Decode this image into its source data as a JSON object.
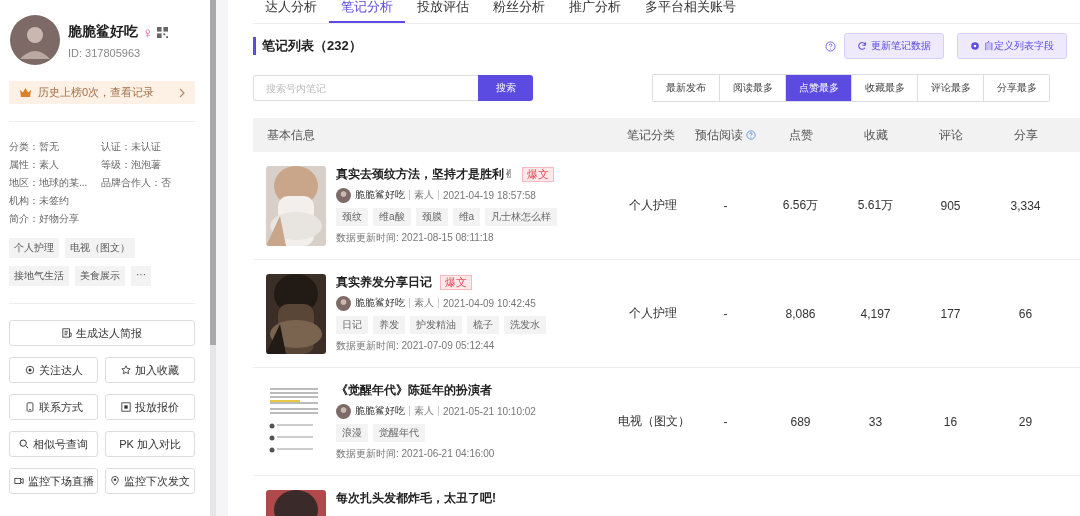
{
  "profile": {
    "name": "脆脆鲨好吃",
    "gender_symbol": "♀",
    "id": "ID: 317805963",
    "history": "历史上榜0次，查看记录",
    "info": [
      [
        "分类：暂无",
        "认证：未认证"
      ],
      [
        "属性：素人",
        "等级：泡泡薯"
      ],
      [
        "地区：地球的某...",
        "品牌合作人：否"
      ],
      [
        "机构：未签约"
      ],
      [
        "简介：好物分享"
      ]
    ],
    "tags": [
      "个人护理",
      "电视（图文）",
      "接地气生活",
      "美食展示",
      "···"
    ],
    "actions": [
      {
        "label": "生成达人简报",
        "wide": true
      },
      {
        "label": "关注达人",
        "wide": false
      },
      {
        "label": "加入收藏",
        "wide": false
      },
      {
        "label": "联系方式",
        "wide": false
      },
      {
        "label": "投放报价",
        "wide": false
      },
      {
        "label": "相似号查询",
        "wide": false
      },
      {
        "label": "PK 加入对比",
        "wide": false
      },
      {
        "label": "监控下场直播",
        "wide": false
      },
      {
        "label": "监控下次发文",
        "wide": false
      }
    ]
  },
  "tabs": [
    {
      "label": "达人分析",
      "selected": false
    },
    {
      "label": "笔记分析",
      "selected": true
    },
    {
      "label": "投放评估",
      "selected": false
    },
    {
      "label": "粉丝分析",
      "selected": false
    },
    {
      "label": "推广分析",
      "selected": false
    },
    {
      "label": "多平台相关账号",
      "selected": false
    }
  ],
  "section": {
    "title": "笔记列表（232）",
    "buttons": [
      "更新笔记数据",
      "自定义列表字段"
    ]
  },
  "search": {
    "placeholder": "搜索号内笔记",
    "button": "搜索"
  },
  "sort_tabs": [
    {
      "label": "最新发布",
      "selected": false
    },
    {
      "label": "阅读最多",
      "selected": false
    },
    {
      "label": "点赞最多",
      "selected": true
    },
    {
      "label": "收藏最多",
      "selected": false
    },
    {
      "label": "评论最多",
      "selected": false
    },
    {
      "label": "分享最多",
      "selected": false
    }
  ],
  "table": {
    "columns": [
      "基本信息",
      "笔记分类",
      "预估阅读",
      "点赞",
      "收藏",
      "评论",
      "分享"
    ],
    "rows": [
      {
        "title": "真实去颈纹方法，坚持才是胜利✌",
        "badge": "爆文",
        "author": "脆脆鲨好吃",
        "role": "素人",
        "time": "2021-04-19 18:57:58",
        "tags": [
          "颈纹",
          "维a酸",
          "颈膜",
          "维a",
          "凡士林怎么样"
        ],
        "updated": "数据更新时间:  2021-08-15 08:11:18",
        "cells": [
          "个人护理",
          "-",
          "6.56万",
          "5.61万",
          "905",
          "3,334"
        ]
      },
      {
        "title": "真实养发分享日记",
        "badge": "爆文",
        "author": "脆脆鲨好吃",
        "role": "素人",
        "time": "2021-04-09 10:42:45",
        "tags": [
          "日记",
          "养发",
          "护发精油",
          "梳子",
          "洗发水"
        ],
        "updated": "数据更新时间:  2021-07-09 05:12:44",
        "cells": [
          "个人护理",
          "-",
          "8,086",
          "4,197",
          "177",
          "66"
        ]
      },
      {
        "title": "《觉醒年代》陈延年的扮演者",
        "author": "脆脆鲨好吃",
        "role": "素人",
        "time": "2021-05-21 10:10:02",
        "tags": [
          "浪漫",
          "觉醒年代"
        ],
        "updated": "数据更新时间:  2021-06-21 04:16:00",
        "cells": [
          "电视（图文）",
          "-",
          "689",
          "33",
          "16",
          "29"
        ]
      },
      {
        "title": "每次扎头发都炸毛，太丑了吧!"
      }
    ]
  }
}
